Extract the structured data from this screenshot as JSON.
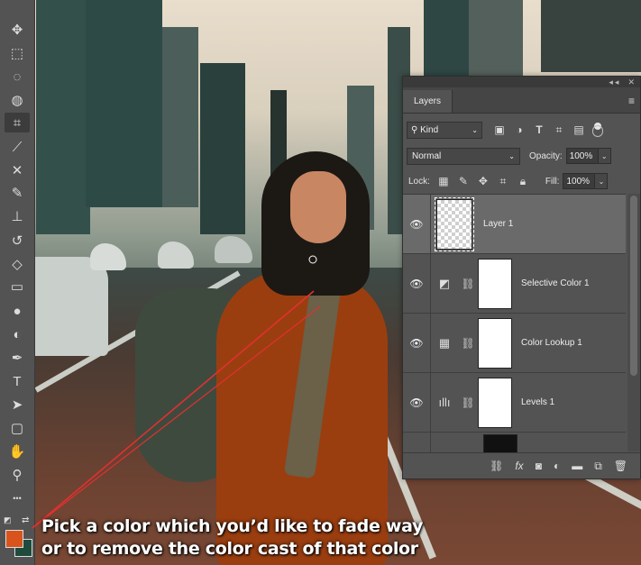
{
  "colors": {
    "foreground": "#d9541c",
    "background": "#1f4b3d",
    "annotation_line": "#e23030"
  },
  "toolbar": {
    "tools": [
      {
        "name": "move-tool-icon",
        "glyph": "✥"
      },
      {
        "name": "marquee-tool-icon",
        "glyph": "⬚"
      },
      {
        "name": "lasso-tool-icon",
        "glyph": "◌"
      },
      {
        "name": "quick-select-tool-icon",
        "glyph": "◍"
      },
      {
        "name": "crop-tool-icon",
        "glyph": "⌗"
      },
      {
        "name": "eyedropper-tool-icon",
        "glyph": "⟋"
      },
      {
        "name": "healing-brush-tool-icon",
        "glyph": "✕"
      },
      {
        "name": "brush-tool-icon",
        "glyph": "✎"
      },
      {
        "name": "clone-stamp-tool-icon",
        "glyph": "⊥"
      },
      {
        "name": "history-brush-tool-icon",
        "glyph": "↺"
      },
      {
        "name": "eraser-tool-icon",
        "glyph": "◇"
      },
      {
        "name": "gradient-tool-icon",
        "glyph": "▭"
      },
      {
        "name": "blur-tool-icon",
        "glyph": "●"
      },
      {
        "name": "dodge-tool-icon",
        "glyph": "◐"
      },
      {
        "name": "pen-tool-icon",
        "glyph": "✒"
      },
      {
        "name": "type-tool-icon",
        "glyph": "T"
      },
      {
        "name": "path-selection-tool-icon",
        "glyph": "➤"
      },
      {
        "name": "rectangle-tool-icon",
        "glyph": "▢"
      },
      {
        "name": "hand-tool-icon",
        "glyph": "✋"
      },
      {
        "name": "zoom-tool-icon",
        "glyph": "⚲"
      },
      {
        "name": "more-tools-icon",
        "glyph": "•••"
      }
    ]
  },
  "panel": {
    "tab": "Layers",
    "filter_kind": "Kind",
    "blend_mode": "Normal",
    "opacity_label": "Opacity:",
    "opacity_value": "100%",
    "lock_label": "Lock:",
    "fill_label": "Fill:",
    "fill_value": "100%",
    "layers": [
      {
        "name": "Layer 1",
        "selected": true,
        "type": "pixel"
      },
      {
        "name": "Selective Color 1",
        "selected": false,
        "type": "selective-color"
      },
      {
        "name": "Color Lookup 1",
        "selected": false,
        "type": "color-lookup"
      },
      {
        "name": "Levels 1",
        "selected": false,
        "type": "levels"
      }
    ]
  },
  "annotation": {
    "line1": "Pick a color which you’d like to fade way",
    "line2": "or to remove the color cast of that color"
  }
}
